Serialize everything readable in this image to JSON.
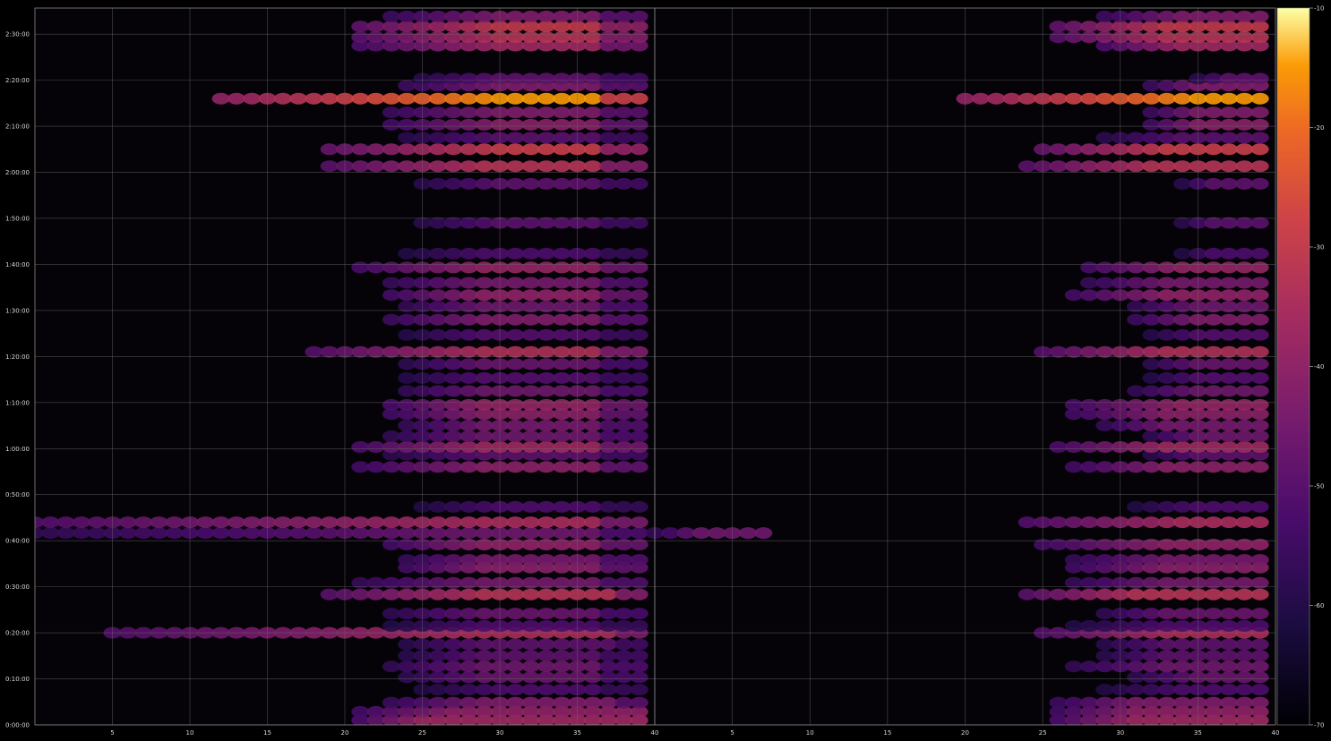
{
  "chart_data": {
    "type": "heatmap",
    "title": "",
    "xlabel": "",
    "ylabel": "",
    "panels": [
      {
        "name": "left",
        "x_range": [
          1,
          40
        ]
      },
      {
        "name": "right",
        "x_range": [
          1,
          40
        ]
      }
    ],
    "x_ticks": [
      5,
      10,
      15,
      20,
      25,
      30,
      35,
      40
    ],
    "x_tick_labels_left": [
      "5",
      "10",
      "15",
      "20",
      "25",
      "30",
      "35",
      "40"
    ],
    "x_tick_labels_right": [
      "5",
      "10",
      "15",
      "20",
      "25",
      "30",
      "35",
      "40"
    ],
    "y_ticks_seconds": [
      0,
      600,
      1200,
      1800,
      2400,
      3000,
      3600,
      4200,
      4800,
      5400,
      6000,
      6600,
      7200,
      7800,
      8400,
      9000
    ],
    "y_tick_labels": [
      "0:00:00",
      "0:10:00",
      "0:20:00",
      "0:30:00",
      "0:40:00",
      "0:50:00",
      "1:00:00",
      "1:10:00",
      "1:20:00",
      "1:30:00",
      "1:40:00",
      "1:50:00",
      "2:00:00",
      "2:10:00",
      "2:20:00",
      "2:30:00"
    ],
    "ylim_seconds": [
      0,
      9340
    ],
    "grid": true,
    "colormap": "inferno",
    "colorbar": {
      "range": [
        -70,
        -10
      ],
      "ticks": [
        -10,
        -20,
        -30,
        -40,
        -50,
        -60,
        -70
      ],
      "tick_labels": [
        "-10",
        "-20",
        "-30",
        "-40",
        "-50",
        "-60",
        "-70"
      ]
    },
    "bands": [
      {
        "t": 60,
        "level": 0.55,
        "left": [
          22,
          40,
          26,
          40
        ],
        "right": [
          27,
          40,
          32,
          40
        ]
      },
      {
        "t": 170,
        "level": 0.5,
        "left": [
          22,
          40,
          28,
          40
        ],
        "right": [
          27,
          40,
          32,
          40
        ]
      },
      {
        "t": 290,
        "level": 0.45,
        "left": [
          24,
          40,
          30,
          38
        ],
        "right": [
          27,
          40,
          32,
          40
        ]
      },
      {
        "t": 460,
        "level": 0.3,
        "left": [
          26,
          40,
          31,
          37
        ],
        "right": [
          30,
          40,
          35,
          40
        ]
      },
      {
        "t": 620,
        "level": 0.38,
        "left": [
          25,
          40,
          30,
          37
        ],
        "right": [
          32,
          40,
          36,
          40
        ]
      },
      {
        "t": 760,
        "level": 0.4,
        "left": [
          24,
          40,
          30,
          37
        ],
        "right": [
          28,
          40,
          34,
          40
        ]
      },
      {
        "t": 900,
        "level": 0.35,
        "left": [
          25,
          40,
          30,
          37
        ],
        "right": [
          30,
          40,
          34,
          40
        ]
      },
      {
        "t": 1050,
        "level": 0.35,
        "left": [
          25,
          40,
          30,
          38
        ],
        "right": [
          30,
          40,
          34,
          40
        ]
      },
      {
        "t": 1200,
        "level": 0.58,
        "left": [
          6,
          40,
          29,
          38
        ],
        "right": [
          26,
          40,
          34,
          40
        ]
      },
      {
        "t": 1290,
        "level": 0.3,
        "left": [
          24,
          40,
          30,
          37
        ],
        "right": [
          28,
          40,
          34,
          40
        ]
      },
      {
        "t": 1450,
        "level": 0.38,
        "left": [
          24,
          40,
          30,
          37
        ],
        "right": [
          30,
          40,
          34,
          40
        ]
      },
      {
        "t": 1700,
        "level": 0.62,
        "left": [
          20,
          40,
          30,
          38
        ],
        "right": [
          25,
          40,
          32,
          40
        ]
      },
      {
        "t": 1850,
        "level": 0.42,
        "left": [
          22,
          40,
          30,
          37
        ],
        "right": [
          28,
          40,
          34,
          40
        ]
      },
      {
        "t": 2050,
        "level": 0.48,
        "left": [
          25,
          40,
          30,
          37
        ],
        "right": [
          28,
          40,
          34,
          40
        ]
      },
      {
        "t": 2150,
        "level": 0.42,
        "left": [
          25,
          40,
          30,
          37
        ],
        "right": [
          28,
          40,
          34,
          40
        ]
      },
      {
        "t": 2350,
        "level": 0.5,
        "left": [
          24,
          40,
          30,
          37
        ],
        "right": [
          26,
          40,
          34,
          40
        ]
      },
      {
        "t": 2500,
        "level": 0.4,
        "left": [
          1,
          40,
          30,
          37
        ],
        "right": [
          1,
          8,
          4,
          40
        ]
      },
      {
        "t": 2640,
        "level": 0.58,
        "left": [
          1,
          40,
          30,
          37
        ],
        "right": [
          25,
          40,
          35,
          40
        ]
      },
      {
        "t": 2840,
        "level": 0.3,
        "left": [
          26,
          40,
          31,
          37
        ],
        "right": [
          32,
          40,
          36,
          40
        ]
      },
      {
        "t": 3360,
        "level": 0.48,
        "left": [
          22,
          40,
          30,
          37
        ],
        "right": [
          28,
          40,
          34,
          40
        ]
      },
      {
        "t": 3520,
        "level": 0.35,
        "left": [
          24,
          40,
          30,
          37
        ],
        "right": [
          33,
          40,
          36,
          40
        ]
      },
      {
        "t": 3620,
        "level": 0.55,
        "left": [
          22,
          40,
          30,
          37
        ],
        "right": [
          27,
          40,
          34,
          40
        ]
      },
      {
        "t": 3760,
        "level": 0.4,
        "left": [
          24,
          40,
          30,
          37
        ],
        "right": [
          33,
          40,
          36,
          40
        ]
      },
      {
        "t": 3900,
        "level": 0.42,
        "left": [
          25,
          40,
          30,
          37
        ],
        "right": [
          30,
          40,
          34,
          40
        ]
      },
      {
        "t": 4050,
        "level": 0.48,
        "left": [
          24,
          40,
          30,
          37
        ],
        "right": [
          28,
          40,
          34,
          40
        ]
      },
      {
        "t": 4170,
        "level": 0.52,
        "left": [
          24,
          40,
          30,
          37
        ],
        "right": [
          28,
          40,
          35,
          40
        ]
      },
      {
        "t": 4350,
        "level": 0.4,
        "left": [
          25,
          40,
          30,
          37
        ],
        "right": [
          32,
          40,
          36,
          40
        ]
      },
      {
        "t": 4520,
        "level": 0.32,
        "left": [
          25,
          40,
          30,
          37
        ],
        "right": [
          33,
          40,
          36,
          40
        ]
      },
      {
        "t": 4700,
        "level": 0.38,
        "left": [
          25,
          40,
          30,
          37
        ],
        "right": [
          33,
          40,
          36,
          40
        ]
      },
      {
        "t": 4860,
        "level": 0.6,
        "left": [
          19,
          40,
          30,
          37
        ],
        "right": [
          26,
          40,
          34,
          40
        ]
      },
      {
        "t": 5080,
        "level": 0.32,
        "left": [
          25,
          40,
          30,
          37
        ],
        "right": [
          33,
          40,
          36,
          40
        ]
      },
      {
        "t": 5280,
        "level": 0.45,
        "left": [
          24,
          40,
          30,
          37
        ],
        "right": [
          32,
          40,
          36,
          40
        ]
      },
      {
        "t": 5450,
        "level": 0.4,
        "left": [
          25,
          40,
          30,
          37
        ],
        "right": [
          32,
          40,
          36,
          40
        ]
      },
      {
        "t": 5600,
        "level": 0.5,
        "left": [
          24,
          40,
          30,
          37
        ],
        "right": [
          28,
          40,
          34,
          40
        ]
      },
      {
        "t": 5760,
        "level": 0.42,
        "left": [
          24,
          40,
          30,
          37
        ],
        "right": [
          29,
          40,
          34,
          40
        ]
      },
      {
        "t": 5960,
        "level": 0.52,
        "left": [
          22,
          40,
          30,
          37
        ],
        "right": [
          29,
          40,
          35,
          40
        ]
      },
      {
        "t": 6140,
        "level": 0.3,
        "left": [
          25,
          40,
          30,
          37
        ],
        "right": [
          35,
          40,
          37,
          40
        ]
      },
      {
        "t": 6540,
        "level": 0.34,
        "left": [
          26,
          40,
          31,
          37
        ],
        "right": [
          35,
          40,
          37,
          40
        ]
      },
      {
        "t": 7050,
        "level": 0.35,
        "left": [
          26,
          40,
          31,
          37
        ],
        "right": [
          35,
          40,
          37,
          40
        ]
      },
      {
        "t": 7280,
        "level": 0.62,
        "left": [
          20,
          40,
          30,
          37
        ],
        "right": [
          25,
          40,
          33,
          40
        ]
      },
      {
        "t": 7500,
        "level": 0.68,
        "left": [
          20,
          40,
          31,
          37
        ],
        "right": [
          26,
          40,
          34,
          40
        ]
      },
      {
        "t": 7650,
        "level": 0.34,
        "left": [
          25,
          40,
          31,
          37
        ],
        "right": [
          30,
          40,
          35,
          40
        ]
      },
      {
        "t": 7820,
        "level": 0.48,
        "left": [
          24,
          40,
          31,
          37
        ],
        "right": [
          33,
          40,
          36,
          40
        ]
      },
      {
        "t": 7980,
        "level": 0.45,
        "left": [
          24,
          40,
          31,
          37
        ],
        "right": [
          33,
          40,
          36,
          40
        ]
      },
      {
        "t": 8160,
        "level": 0.92,
        "left": [
          13,
          40,
          31,
          37
        ],
        "right": [
          21,
          40,
          36,
          40
        ]
      },
      {
        "t": 8330,
        "level": 0.45,
        "left": [
          25,
          40,
          31,
          37
        ],
        "right": [
          33,
          40,
          36,
          40
        ]
      },
      {
        "t": 8420,
        "level": 0.35,
        "left": [
          26,
          40,
          31,
          37
        ],
        "right": [
          36,
          40,
          38,
          40
        ]
      },
      {
        "t": 8850,
        "level": 0.55,
        "left": [
          22,
          40,
          31,
          37
        ],
        "right": [
          30,
          40,
          35,
          40
        ]
      },
      {
        "t": 8960,
        "level": 0.62,
        "left": [
          22,
          40,
          31,
          37
        ],
        "right": [
          27,
          40,
          34,
          40
        ]
      },
      {
        "t": 9100,
        "level": 0.66,
        "left": [
          22,
          40,
          31,
          37
        ],
        "right": [
          27,
          40,
          34,
          40
        ]
      },
      {
        "t": 9230,
        "level": 0.45,
        "left": [
          24,
          40,
          31,
          37
        ],
        "right": [
          30,
          40,
          35,
          40
        ]
      }
    ]
  }
}
